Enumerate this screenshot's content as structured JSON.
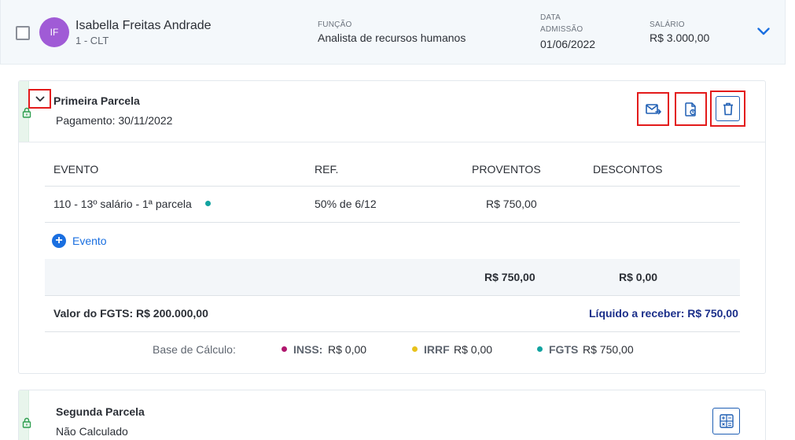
{
  "employee": {
    "initials": "IF",
    "name": "Isabella Freitas Andrade",
    "contract": "1 - CLT",
    "role_label": "FUNÇÃO",
    "role_value": "Analista de recursos humanos",
    "admission_label_line1": "DATA",
    "admission_label_line2": "ADMISSÃO",
    "admission_value": "01/06/2022",
    "salary_label": "SALÁRIO",
    "salary_value": "R$ 3.000,00"
  },
  "parcel1": {
    "title": "Primeira Parcela",
    "payment": "Pagamento: 30/11/2022",
    "actions": [
      "mail-send-icon",
      "document-refresh-icon",
      "trash-icon"
    ],
    "table": {
      "headers": [
        "EVENTO",
        "REF.",
        "PROVENTOS",
        "DESCONTOS"
      ],
      "rows": [
        {
          "evento": "110 - 13º salário - 1ª parcela",
          "ref": "50% de 6/12",
          "proventos": "R$ 750,00",
          "descontos": ""
        }
      ],
      "add_event_label": "Evento",
      "total_proventos": "R$ 750,00",
      "total_descontos": "R$ 0,00"
    },
    "fgts_value_text": "Valor do FGTS: R$ 200.000,00",
    "liquid_text": "Líquido a receber: R$ 750,00",
    "base_calc_label": "Base de Cálculo:",
    "bases": [
      {
        "name": "INSS:",
        "value": "R$ 0,00",
        "color": "#b0176e"
      },
      {
        "name": "IRRF",
        "value": "R$ 0,00",
        "color": "#e8c21c"
      },
      {
        "name": "FGTS",
        "value": "R$ 750,00",
        "color": "#12a3a0"
      }
    ]
  },
  "parcel2": {
    "title": "Segunda Parcela",
    "status": "Não Calculado"
  },
  "colors": {
    "accent": "#1a6fe0",
    "avatar": "#a05bd6",
    "highlight": "#e31b1b",
    "event_dot": "#12a3a0"
  }
}
